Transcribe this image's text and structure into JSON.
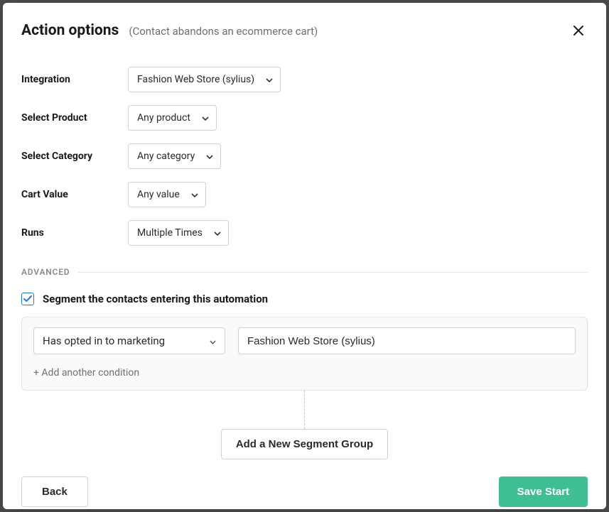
{
  "header": {
    "title": "Action options",
    "subtitle": "(Contact abandons an ecommerce cart)"
  },
  "form": {
    "integration": {
      "label": "Integration",
      "value": "Fashion Web Store (sylius)"
    },
    "product": {
      "label": "Select Product",
      "value": "Any product"
    },
    "category": {
      "label": "Select Category",
      "value": "Any category"
    },
    "cart_value": {
      "label": "Cart Value",
      "value": "Any value"
    },
    "runs": {
      "label": "Runs",
      "value": "Multiple Times"
    }
  },
  "advanced": {
    "section_label": "ADVANCED",
    "segment_checkbox_label": "Segment the contacts entering this automation",
    "segment_checked": true,
    "condition": {
      "field": "Has opted in to marketing",
      "value": "Fashion Web Store (sylius)"
    },
    "add_condition_label": "+ Add another condition",
    "add_group_label": "Add a New Segment Group"
  },
  "footer": {
    "back_label": "Back",
    "save_label": "Save Start"
  }
}
